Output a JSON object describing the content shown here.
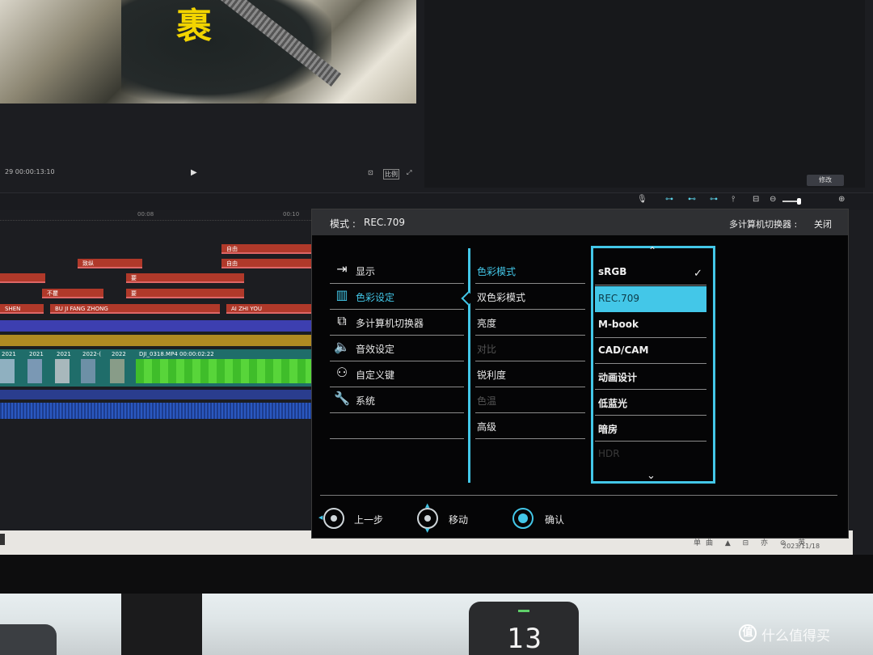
{
  "editor": {
    "preview_char": "裹",
    "src_timecode": "29   00:00:13:10",
    "play_icon": "▶",
    "ratio_label": "比例",
    "modify_button": "修改",
    "ruler": [
      "00:08",
      "00:10"
    ],
    "clips": {
      "row1": "自由",
      "row2a": "致纵",
      "row2b": "自由",
      "row3": "要",
      "row4a": "不瞿",
      "row4b": "要",
      "row5a": "SHEN",
      "row5b": "BU JI FANG ZHONG",
      "row5c": "AI ZHI YOU"
    },
    "video_labels": [
      "2021",
      "2021",
      "2021",
      "2022-(",
      "2022",
      "DJI_0318.MP4",
      "00:00:02:22"
    ],
    "taskbar_icons": "单曲 ▲ ⊟ 亦 ⊘ 英",
    "taskbar_date": "2023/11/18"
  },
  "osd": {
    "header": {
      "mode_label": "模式 :",
      "mode_value": "REC.709",
      "kvm_label": "多计算机切换器 :",
      "kvm_value": "关闭"
    },
    "main_menu": [
      {
        "label": "显示",
        "icon": "input-icon",
        "active": false
      },
      {
        "label": "色彩设定",
        "icon": "chart-icon",
        "active": true
      },
      {
        "label": "多计算机切换器",
        "icon": "kvm-icon",
        "active": false
      },
      {
        "label": "音效设定",
        "icon": "speaker-icon",
        "active": false
      },
      {
        "label": "自定义键",
        "icon": "user-icon",
        "active": false
      },
      {
        "label": "系统",
        "icon": "wrench-icon",
        "active": false
      },
      {
        "label": "",
        "icon": "",
        "active": false
      }
    ],
    "sub_menu": [
      {
        "label": "色彩模式",
        "state": "active"
      },
      {
        "label": "双色彩模式",
        "state": "normal"
      },
      {
        "label": "亮度",
        "state": "normal"
      },
      {
        "label": "对比",
        "state": "disabled"
      },
      {
        "label": "锐利度",
        "state": "normal"
      },
      {
        "label": "色温",
        "state": "disabled"
      },
      {
        "label": "高级",
        "state": "normal"
      }
    ],
    "options": [
      {
        "label": "sRGB",
        "state": "checked"
      },
      {
        "label": "REC.709",
        "state": "selected"
      },
      {
        "label": "M-book",
        "state": "normal"
      },
      {
        "label": "CAD/CAM",
        "state": "normal"
      },
      {
        "label": "动画设计",
        "state": "normal"
      },
      {
        "label": "低蓝光",
        "state": "normal"
      },
      {
        "label": "暗房",
        "state": "normal"
      },
      {
        "label": "HDR",
        "state": "disabled"
      }
    ],
    "check_mark": "✓",
    "up_arrow": "⌃",
    "down_arrow": "⌄",
    "footer": {
      "back_label": "上一步",
      "move_label": "移动",
      "confirm_label": "确认"
    },
    "accent_color": "#43c7e8"
  },
  "desk": {
    "clock_number": "13",
    "watermark": "什么值得买",
    "watermark_icon": "值"
  }
}
